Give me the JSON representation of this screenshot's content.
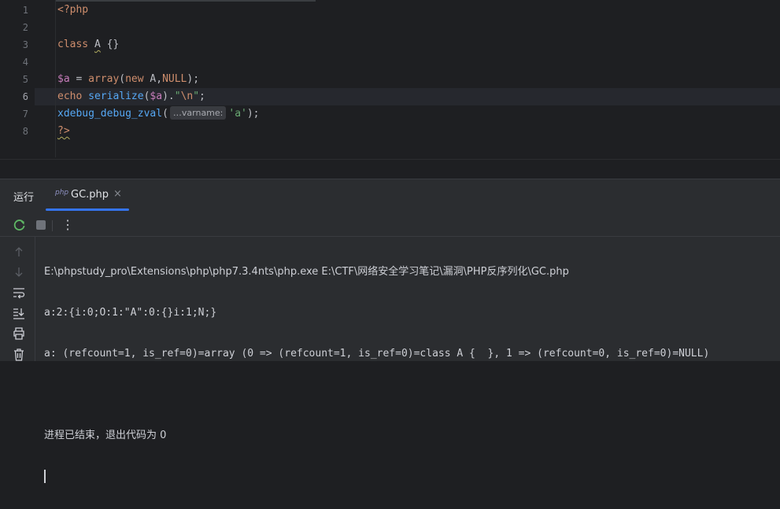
{
  "editor": {
    "line_numbers": [
      "1",
      "2",
      "3",
      "4",
      "5",
      "6",
      "7",
      "8"
    ],
    "active_line": "6",
    "lines": {
      "l1": "<?php",
      "l3_kw": "class",
      "l3_name": "A",
      "l3_rest": "{}",
      "l5_var": "$a",
      "l5_eq": " = ",
      "l5_fn": "array",
      "l5_open": "(",
      "l5_new": "new",
      "l5_rest": " A,",
      "l5_null": "NULL",
      "l5_end": ");",
      "l6_echo": "echo",
      "l6_fn": "serialize",
      "l6_open": "(",
      "l6_var": "$a",
      "l6_mid": ").",
      "l6_q1": "\"",
      "l6_esc": "\\n",
      "l6_q2": "\"",
      "l6_end": ";",
      "l7_fn": "xdebug_debug_zval",
      "l7_open": "(",
      "l7_hint": "…varname:",
      "l7_str": "'a'",
      "l7_end": ");",
      "l8": "?>"
    }
  },
  "run_panel": {
    "title": "运行",
    "tab_icon": "php",
    "tab_label": "GC.php",
    "tab_close": "×",
    "more_label": "⋮"
  },
  "console": {
    "lines": [
      "E:\\phpstudy_pro\\Extensions\\php\\php7.3.4nts\\php.exe E:\\CTF\\网络安全学习笔记\\漏洞\\PHP反序列化\\GC.php",
      "a:2:{i:0;O:1:\"A\":0:{}i:1;N;}",
      "a: (refcount=1, is_ref=0)=array (0 => (refcount=1, is_ref=0)=class A {  }, 1 => (refcount=0, is_ref=0)=NULL)",
      "",
      "进程已结束，退出代码为 0"
    ]
  }
}
